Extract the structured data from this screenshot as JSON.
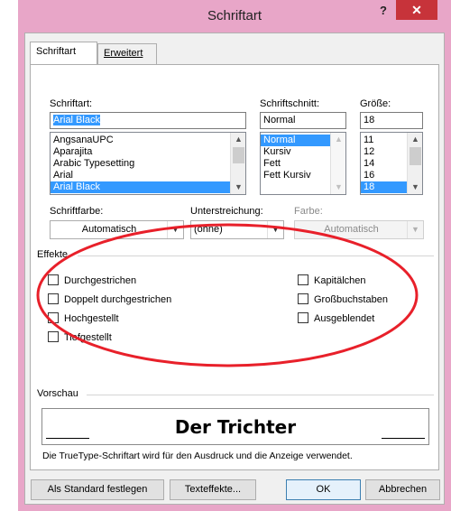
{
  "window": {
    "title": "Schriftart",
    "help_label": "?",
    "close_label": "✕"
  },
  "tabs": [
    {
      "label": "Schriftart",
      "active": true
    },
    {
      "label": "Erweitert",
      "active": false
    }
  ],
  "font": {
    "label": "Schriftart:",
    "value": "Arial Black",
    "options": [
      "AngsanaUPC",
      "Aparajita",
      "Arabic Typesetting",
      "Arial",
      "Arial Black"
    ],
    "selected": "Arial Black"
  },
  "style": {
    "label": "Schriftschnitt:",
    "value": "Normal",
    "options": [
      "Normal",
      "Kursiv",
      "Fett",
      "Fett Kursiv"
    ],
    "selected": "Normal"
  },
  "size": {
    "label": "Größe:",
    "value": "18",
    "options": [
      "11",
      "12",
      "14",
      "16",
      "18"
    ],
    "selected": "18"
  },
  "font_color": {
    "label": "Schriftfarbe:",
    "value": "Automatisch"
  },
  "underline": {
    "label": "Unterstreichung:",
    "value": "(ohne)"
  },
  "underline_color": {
    "label": "Farbe:",
    "value": "Automatisch",
    "disabled": true
  },
  "effects": {
    "label": "Effekte",
    "left": [
      {
        "label": "Durchgestrichen",
        "checked": false
      },
      {
        "label": "Doppelt durchgestrichen",
        "checked": false
      },
      {
        "label": "Hochgestellt",
        "checked": false
      },
      {
        "label": "Tiefgestellt",
        "checked": false
      }
    ],
    "right": [
      {
        "label": "Kapitälchen",
        "checked": false
      },
      {
        "label": "Großbuchstaben",
        "checked": false
      },
      {
        "label": "Ausgeblendet",
        "checked": false
      }
    ]
  },
  "preview": {
    "label": "Vorschau",
    "sample": "Der Trichter",
    "description": "Die TrueType-Schriftart wird für den Ausdruck und die Anzeige verwendet."
  },
  "buttons": {
    "set_default": "Als Standard festlegen",
    "text_effects": "Texteffekte...",
    "ok": "OK",
    "cancel": "Abbrechen"
  },
  "colors": {
    "window_frame": "#e8a6c8",
    "close_button": "#c7333a",
    "selection": "#3399ff",
    "annotation_ellipse": "#e8202a"
  }
}
